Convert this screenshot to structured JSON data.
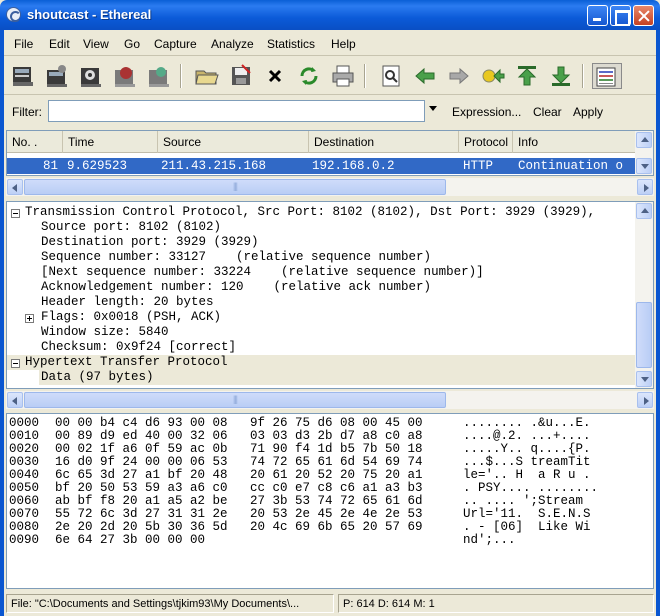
{
  "window": {
    "title": "shoutcast - Ethereal"
  },
  "menu": [
    "File",
    "Edit",
    "View",
    "Go",
    "Capture",
    "Analyze",
    "Statistics",
    "Help"
  ],
  "toolbar": {
    "icons": [
      "interface-list-icon",
      "capture-options-icon",
      "capture-start-icon",
      "capture-stop-icon",
      "capture-restart-icon",
      "open-file-icon",
      "save-file-icon",
      "close-file-icon",
      "reload-icon",
      "print-icon",
      "find-packet-icon",
      "go-back-icon",
      "go-forward-icon",
      "go-to-packet-icon",
      "go-first-icon",
      "go-last-icon",
      "colorize-icon"
    ]
  },
  "filter": {
    "label": "Filter:",
    "value": "",
    "expression_label": "Expression...",
    "clear_label": "Clear",
    "apply_label": "Apply"
  },
  "packet_list": {
    "columns": [
      "No. .",
      "Time",
      "Source",
      "Destination",
      "Protocol",
      "Info"
    ],
    "selected_row": {
      "no": "81",
      "time": "9.629523",
      "source": "211.43.215.168",
      "destination": "192.168.0.2",
      "protocol": "HTTP",
      "info": "Continuation o"
    }
  },
  "details": {
    "tcp_header": "Transmission Control Protocol, Src Port: 8102 (8102), Dst Port: 3929 (3929),",
    "tcp_fields": [
      "Source port: 8102 (8102)",
      "Destination port: 3929 (3929)",
      "Sequence number: 33127    (relative sequence number)",
      "[Next sequence number: 33224    (relative sequence number)]",
      "Acknowledgement number: 120    (relative ack number)",
      "Header length: 20 bytes",
      "Flags: 0x0018 (PSH, ACK)",
      "Window size: 5840",
      "Checksum: 0x9f24 [correct]"
    ],
    "http_header": "Hypertext Transfer Protocol",
    "data_field": "Data (97 bytes)"
  },
  "hex": [
    {
      "offset": "0000",
      "bytes": "00 00 b4 c4 d6 93 00 08   9f 26 75 d6 08 00 45 00",
      "ascii": "........ .&u...E."
    },
    {
      "offset": "0010",
      "bytes": "00 89 d9 ed 40 00 32 06   03 03 d3 2b d7 a8 c0 a8",
      "ascii": "....@.2. ...+...."
    },
    {
      "offset": "0020",
      "bytes": "00 02 1f a6 0f 59 ac 0b   71 90 f4 1d b5 7b 50 18",
      "ascii": ".....Y.. q....{P."
    },
    {
      "offset": "0030",
      "bytes": "16 d0 9f 24 00 00 06 53   74 72 65 61 6d 54 69 74",
      "ascii": "...$...S treamTit"
    },
    {
      "offset": "0040",
      "bytes": "6c 65 3d 27 a1 bf 20 48   20 61 20 52 20 75 20 a1",
      "ascii": "le='.. H  a R u ."
    },
    {
      "offset": "0050",
      "bytes": "bf 20 50 53 59 a3 a6 c0   cc c0 e7 c8 c6 a1 a3 b3",
      "ascii": ". PSY.... ........"
    },
    {
      "offset": "0060",
      "bytes": "ab bf f8 20 a1 a5 a2 be   27 3b 53 74 72 65 61 6d",
      "ascii": ".. .... ';Stream"
    },
    {
      "offset": "0070",
      "bytes": "55 72 6c 3d 27 31 31 2e   20 53 2e 45 2e 4e 2e 53",
      "ascii": "Url='11.  S.E.N.S"
    },
    {
      "offset": "0080",
      "bytes": "2e 20 2d 20 5b 30 36 5d   20 4c 69 6b 65 20 57 69",
      "ascii": ". - [06]  Like Wi"
    },
    {
      "offset": "0090",
      "bytes": "6e 64 27 3b 00 00 00",
      "ascii": "nd';..."
    }
  ],
  "status": {
    "file": "File: \"C:\\Documents and Settings\\tjkim93\\My Documents\\...",
    "counts": "P: 614 D: 614 M: 1"
  },
  "colors": {
    "selection": "#3169c6",
    "title_bar": "#0a5fd6"
  }
}
